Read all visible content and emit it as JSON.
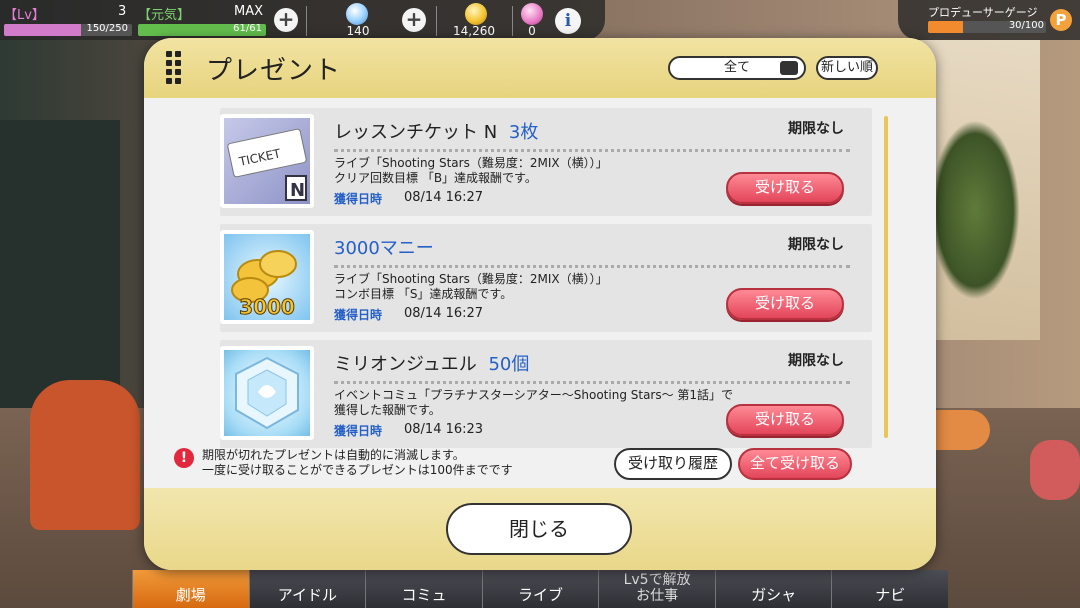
{
  "status": {
    "lv_label": "【Lv】",
    "lv_value": "3",
    "lv_exp": "150/250",
    "lv_progress": 0.6,
    "stamina_label": "【元気】",
    "stamina_max_label": "MAX",
    "stamina_value": "61/61",
    "stamina_progress": 1.0,
    "jewel_count": "140",
    "money_count": "14,260",
    "ticket_count": "0",
    "info_label": "i",
    "plus_label": "+"
  },
  "gauge": {
    "label": "プロデューサーゲージ",
    "value": "30/100",
    "progress": 0.3,
    "icon_label": "P"
  },
  "modal": {
    "title": "プレゼント",
    "filter_label": "全て",
    "sort_label": "新しい順",
    "items": [
      {
        "name": "レッスンチケット N",
        "qty": "3枚",
        "limit": "期限なし",
        "desc_line1": "ライブ「Shooting Stars（難易度：2MIX（横））」",
        "desc_line2": "クリア回数目標 「B」達成報酬です。",
        "date_label": "獲得日時",
        "date": "08/14 16:27",
        "claim_label": "受け取る",
        "thumb_text": "TICKET",
        "thumb_badge": "N"
      },
      {
        "name": "3000マニー",
        "qty": "",
        "limit": "期限なし",
        "desc_line1": "ライブ「Shooting Stars（難易度：2MIX（横））」",
        "desc_line2": "コンボ目標 「S」達成報酬です。",
        "date_label": "獲得日時",
        "date": "08/14 16:27",
        "claim_label": "受け取る",
        "thumb_text": "3000"
      },
      {
        "name": "ミリオンジュエル",
        "qty": "50個",
        "limit": "期限なし",
        "desc_line1": "イベントコミュ「プラチナスターシアター～Shooting Stars～ 第1話」で",
        "desc_line2": "獲得した報酬です。",
        "date_label": "獲得日時",
        "date": "08/14 16:23",
        "claim_label": "受け取る"
      }
    ],
    "note_line1": "期限が切れたプレゼントは自動的に消滅します。",
    "note_line2": "一度に受け取ることができるプレゼントは100件までです",
    "warn_icon": "!",
    "history_label": "受け取り履歴",
    "claim_all_label": "全て受け取る",
    "close_label": "閉じる"
  },
  "nav": {
    "tabs": [
      "劇場",
      "アイドル",
      "コミュ",
      "ライブ",
      "Lv5で解放",
      "ガシャ",
      "ナビ"
    ],
    "locked_sub": "お仕事"
  },
  "colors": {
    "accent_blue": "#2460c8",
    "claim_red": "#e3455a",
    "header_yellow": "#e7d47e"
  }
}
